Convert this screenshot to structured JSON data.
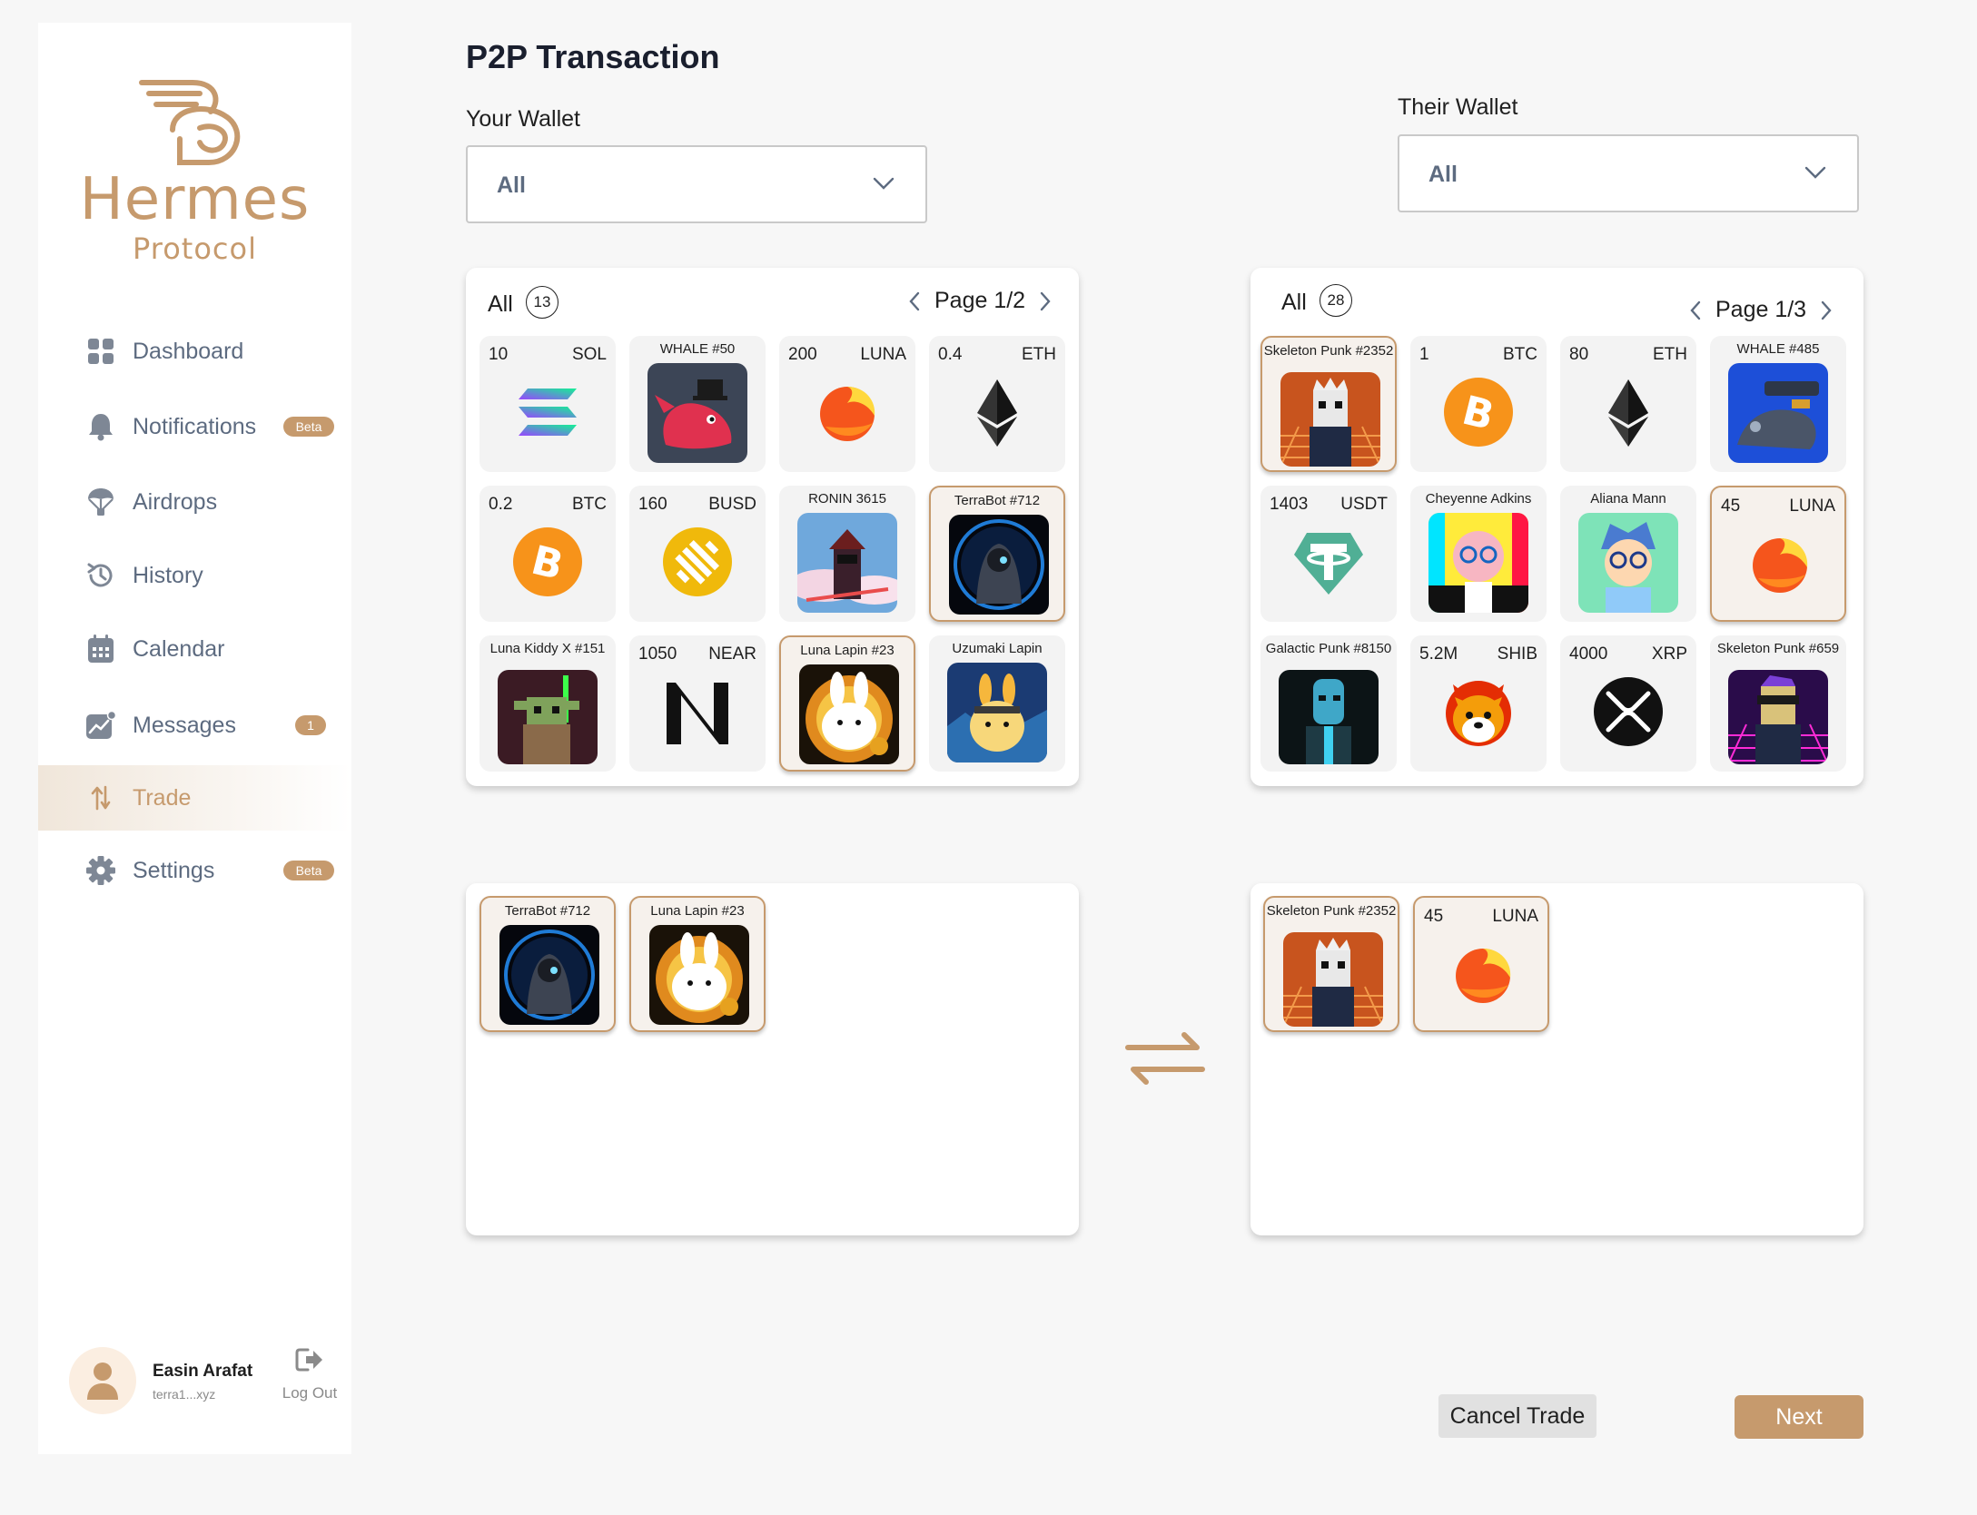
{
  "brand": {
    "name": "Hermes",
    "subtitle": "Protocol",
    "color": "#c69a6d"
  },
  "nav": [
    {
      "label": "Dashboard",
      "icon": "grid-icon",
      "badge": ""
    },
    {
      "label": "Notifications",
      "icon": "bell-icon",
      "badge": "Beta"
    },
    {
      "label": "Airdrops",
      "icon": "parachute-icon",
      "badge": ""
    },
    {
      "label": "History",
      "icon": "history-icon",
      "badge": ""
    },
    {
      "label": "Calendar",
      "icon": "calendar-icon",
      "badge": ""
    },
    {
      "label": "Messages",
      "icon": "chart-message-icon",
      "badge": "1"
    },
    {
      "label": "Trade",
      "icon": "trade-arrows-icon",
      "badge": "",
      "active": true
    },
    {
      "label": "Settings",
      "icon": "gear-icon",
      "badge": "Beta"
    }
  ],
  "profile": {
    "name": "Easin Arafat",
    "address": "terra1...xyz",
    "logout": "Log Out"
  },
  "page": {
    "title": "P2P Transaction"
  },
  "your_wallet": {
    "label": "Your Wallet",
    "selected": "All",
    "filter": "All",
    "count": "13",
    "page": "Page 1/2",
    "items": [
      {
        "type": "token",
        "amount": "10",
        "symbol": "SOL",
        "icon": "solana-icon"
      },
      {
        "type": "nft",
        "name": "WHALE #50",
        "image": "whale-nft"
      },
      {
        "type": "token",
        "amount": "200",
        "symbol": "LUNA",
        "icon": "terra-luna-icon"
      },
      {
        "type": "token",
        "amount": "0.4",
        "symbol": "ETH",
        "icon": "ethereum-icon"
      },
      {
        "type": "token",
        "amount": "0.2",
        "symbol": "BTC",
        "icon": "bitcoin-icon"
      },
      {
        "type": "token",
        "amount": "160",
        "symbol": "BUSD",
        "icon": "busd-icon"
      },
      {
        "type": "nft",
        "name": "RONIN 3615",
        "image": "ronin-nft"
      },
      {
        "type": "nft",
        "name": "TerraBot #712",
        "image": "terrabot-nft",
        "selected": true
      },
      {
        "type": "nft",
        "name": "Luna Kiddy X #151",
        "image": "yoda-nft"
      },
      {
        "type": "token",
        "amount": "1050",
        "symbol": "NEAR",
        "icon": "near-icon"
      },
      {
        "type": "nft",
        "name": "Luna Lapin #23",
        "image": "lapin-nft",
        "selected": true
      },
      {
        "type": "nft",
        "name": "Uzumaki Lapin",
        "image": "uzumaki-nft"
      }
    ],
    "offer": [
      {
        "type": "nft",
        "name": "TerraBot #712",
        "image": "terrabot-nft"
      },
      {
        "type": "nft",
        "name": "Luna Lapin #23",
        "image": "lapin-nft"
      }
    ]
  },
  "their_wallet": {
    "label": "Their Wallet",
    "selected": "All",
    "filter": "All",
    "count": "28",
    "page": "Page 1/3",
    "items": [
      {
        "type": "nft",
        "name": "Skeleton Punk #2352",
        "image": "skeleton-punk-nft",
        "selected": true
      },
      {
        "type": "token",
        "amount": "1",
        "symbol": "BTC",
        "icon": "bitcoin-icon"
      },
      {
        "type": "token",
        "amount": "80",
        "symbol": "ETH",
        "icon": "ethereum-icon"
      },
      {
        "type": "nft",
        "name": "WHALE #485",
        "image": "whale-mech-nft"
      },
      {
        "type": "token",
        "amount": "1403",
        "symbol": "USDT",
        "icon": "tether-icon"
      },
      {
        "type": "nft",
        "name": "Cheyenne Adkins",
        "image": "cheyenne-nft"
      },
      {
        "type": "nft",
        "name": "Aliana Mann",
        "image": "aliana-nft"
      },
      {
        "type": "token",
        "amount": "45",
        "symbol": "LUNA",
        "icon": "terra-luna-icon",
        "selected": true
      },
      {
        "type": "nft",
        "name": "Galactic Punk #8150",
        "image": "galactic-punk-nft"
      },
      {
        "type": "token",
        "amount": "5.2M",
        "symbol": "SHIB",
        "icon": "shiba-icon"
      },
      {
        "type": "token",
        "amount": "4000",
        "symbol": "XRP",
        "icon": "xrp-icon"
      },
      {
        "type": "nft",
        "name": "Skeleton Punk #659",
        "image": "skeleton-punk-2-nft"
      }
    ],
    "offer": [
      {
        "type": "nft",
        "name": "Skeleton Punk #2352",
        "image": "skeleton-punk-nft"
      },
      {
        "type": "token",
        "amount": "45",
        "symbol": "LUNA",
        "icon": "terra-luna-icon"
      }
    ]
  },
  "actions": {
    "cancel": "Cancel Trade",
    "next": "Next"
  }
}
